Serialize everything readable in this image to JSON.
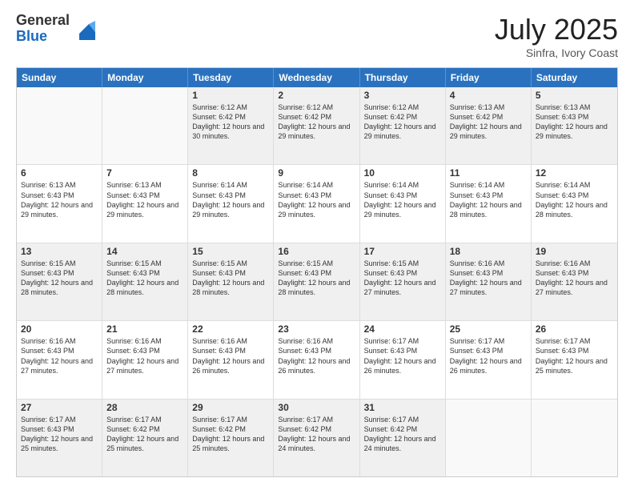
{
  "logo": {
    "general": "General",
    "blue": "Blue"
  },
  "header": {
    "month": "July 2025",
    "location": "Sinfra, Ivory Coast"
  },
  "weekdays": [
    "Sunday",
    "Monday",
    "Tuesday",
    "Wednesday",
    "Thursday",
    "Friday",
    "Saturday"
  ],
  "rows": [
    [
      {
        "day": "",
        "empty": true
      },
      {
        "day": "",
        "empty": true
      },
      {
        "day": "1",
        "sunrise": "Sunrise: 6:12 AM",
        "sunset": "Sunset: 6:42 PM",
        "daylight": "Daylight: 12 hours and 30 minutes."
      },
      {
        "day": "2",
        "sunrise": "Sunrise: 6:12 AM",
        "sunset": "Sunset: 6:42 PM",
        "daylight": "Daylight: 12 hours and 29 minutes."
      },
      {
        "day": "3",
        "sunrise": "Sunrise: 6:12 AM",
        "sunset": "Sunset: 6:42 PM",
        "daylight": "Daylight: 12 hours and 29 minutes."
      },
      {
        "day": "4",
        "sunrise": "Sunrise: 6:13 AM",
        "sunset": "Sunset: 6:42 PM",
        "daylight": "Daylight: 12 hours and 29 minutes."
      },
      {
        "day": "5",
        "sunrise": "Sunrise: 6:13 AM",
        "sunset": "Sunset: 6:43 PM",
        "daylight": "Daylight: 12 hours and 29 minutes."
      }
    ],
    [
      {
        "day": "6",
        "sunrise": "Sunrise: 6:13 AM",
        "sunset": "Sunset: 6:43 PM",
        "daylight": "Daylight: 12 hours and 29 minutes."
      },
      {
        "day": "7",
        "sunrise": "Sunrise: 6:13 AM",
        "sunset": "Sunset: 6:43 PM",
        "daylight": "Daylight: 12 hours and 29 minutes."
      },
      {
        "day": "8",
        "sunrise": "Sunrise: 6:14 AM",
        "sunset": "Sunset: 6:43 PM",
        "daylight": "Daylight: 12 hours and 29 minutes."
      },
      {
        "day": "9",
        "sunrise": "Sunrise: 6:14 AM",
        "sunset": "Sunset: 6:43 PM",
        "daylight": "Daylight: 12 hours and 29 minutes."
      },
      {
        "day": "10",
        "sunrise": "Sunrise: 6:14 AM",
        "sunset": "Sunset: 6:43 PM",
        "daylight": "Daylight: 12 hours and 29 minutes."
      },
      {
        "day": "11",
        "sunrise": "Sunrise: 6:14 AM",
        "sunset": "Sunset: 6:43 PM",
        "daylight": "Daylight: 12 hours and 28 minutes."
      },
      {
        "day": "12",
        "sunrise": "Sunrise: 6:14 AM",
        "sunset": "Sunset: 6:43 PM",
        "daylight": "Daylight: 12 hours and 28 minutes."
      }
    ],
    [
      {
        "day": "13",
        "sunrise": "Sunrise: 6:15 AM",
        "sunset": "Sunset: 6:43 PM",
        "daylight": "Daylight: 12 hours and 28 minutes."
      },
      {
        "day": "14",
        "sunrise": "Sunrise: 6:15 AM",
        "sunset": "Sunset: 6:43 PM",
        "daylight": "Daylight: 12 hours and 28 minutes."
      },
      {
        "day": "15",
        "sunrise": "Sunrise: 6:15 AM",
        "sunset": "Sunset: 6:43 PM",
        "daylight": "Daylight: 12 hours and 28 minutes."
      },
      {
        "day": "16",
        "sunrise": "Sunrise: 6:15 AM",
        "sunset": "Sunset: 6:43 PM",
        "daylight": "Daylight: 12 hours and 28 minutes."
      },
      {
        "day": "17",
        "sunrise": "Sunrise: 6:15 AM",
        "sunset": "Sunset: 6:43 PM",
        "daylight": "Daylight: 12 hours and 27 minutes."
      },
      {
        "day": "18",
        "sunrise": "Sunrise: 6:16 AM",
        "sunset": "Sunset: 6:43 PM",
        "daylight": "Daylight: 12 hours and 27 minutes."
      },
      {
        "day": "19",
        "sunrise": "Sunrise: 6:16 AM",
        "sunset": "Sunset: 6:43 PM",
        "daylight": "Daylight: 12 hours and 27 minutes."
      }
    ],
    [
      {
        "day": "20",
        "sunrise": "Sunrise: 6:16 AM",
        "sunset": "Sunset: 6:43 PM",
        "daylight": "Daylight: 12 hours and 27 minutes."
      },
      {
        "day": "21",
        "sunrise": "Sunrise: 6:16 AM",
        "sunset": "Sunset: 6:43 PM",
        "daylight": "Daylight: 12 hours and 27 minutes."
      },
      {
        "day": "22",
        "sunrise": "Sunrise: 6:16 AM",
        "sunset": "Sunset: 6:43 PM",
        "daylight": "Daylight: 12 hours and 26 minutes."
      },
      {
        "day": "23",
        "sunrise": "Sunrise: 6:16 AM",
        "sunset": "Sunset: 6:43 PM",
        "daylight": "Daylight: 12 hours and 26 minutes."
      },
      {
        "day": "24",
        "sunrise": "Sunrise: 6:17 AM",
        "sunset": "Sunset: 6:43 PM",
        "daylight": "Daylight: 12 hours and 26 minutes."
      },
      {
        "day": "25",
        "sunrise": "Sunrise: 6:17 AM",
        "sunset": "Sunset: 6:43 PM",
        "daylight": "Daylight: 12 hours and 26 minutes."
      },
      {
        "day": "26",
        "sunrise": "Sunrise: 6:17 AM",
        "sunset": "Sunset: 6:43 PM",
        "daylight": "Daylight: 12 hours and 25 minutes."
      }
    ],
    [
      {
        "day": "27",
        "sunrise": "Sunrise: 6:17 AM",
        "sunset": "Sunset: 6:43 PM",
        "daylight": "Daylight: 12 hours and 25 minutes."
      },
      {
        "day": "28",
        "sunrise": "Sunrise: 6:17 AM",
        "sunset": "Sunset: 6:42 PM",
        "daylight": "Daylight: 12 hours and 25 minutes."
      },
      {
        "day": "29",
        "sunrise": "Sunrise: 6:17 AM",
        "sunset": "Sunset: 6:42 PM",
        "daylight": "Daylight: 12 hours and 25 minutes."
      },
      {
        "day": "30",
        "sunrise": "Sunrise: 6:17 AM",
        "sunset": "Sunset: 6:42 PM",
        "daylight": "Daylight: 12 hours and 24 minutes."
      },
      {
        "day": "31",
        "sunrise": "Sunrise: 6:17 AM",
        "sunset": "Sunset: 6:42 PM",
        "daylight": "Daylight: 12 hours and 24 minutes."
      },
      {
        "day": "",
        "empty": true
      },
      {
        "day": "",
        "empty": true
      }
    ]
  ]
}
